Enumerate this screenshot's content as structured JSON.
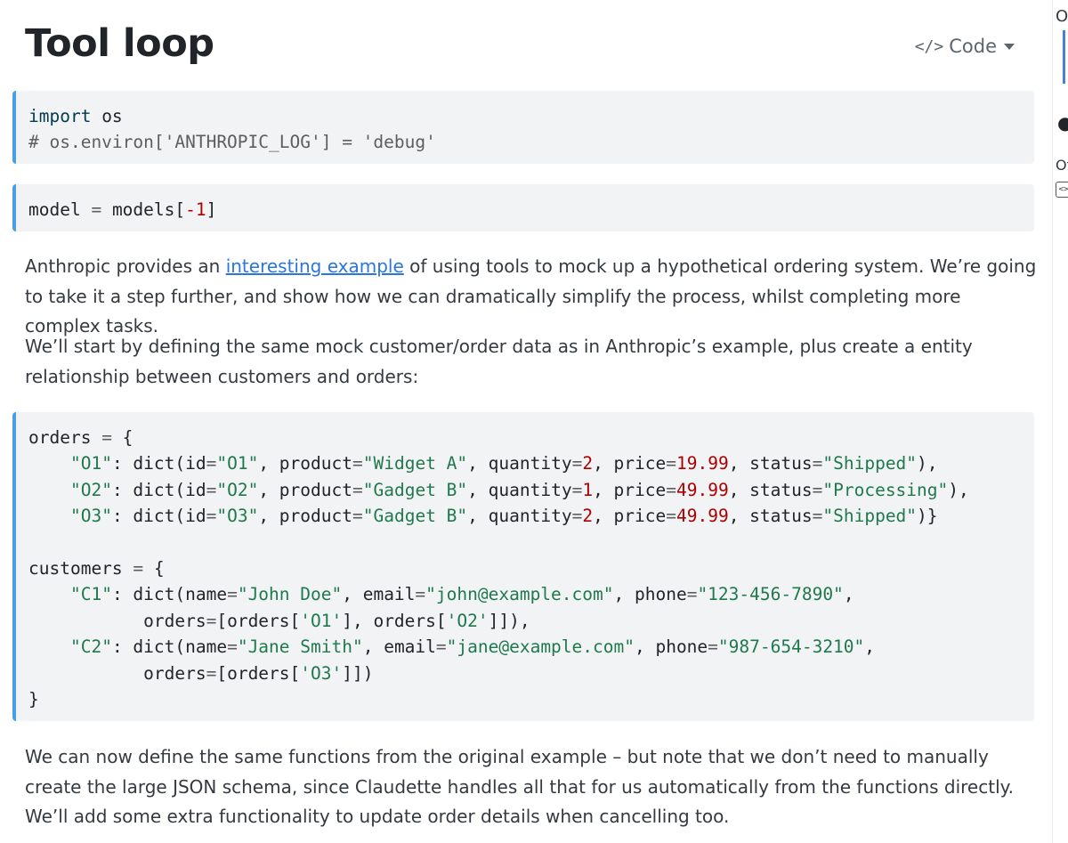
{
  "header": {
    "title": "Tool loop",
    "code_toggle_label": "Code"
  },
  "code_cells": [
    {
      "lines": [
        [
          {
            "t": "import",
            "c": "kw"
          },
          {
            "t": " os",
            "c": ""
          }
        ],
        [
          {
            "t": "# os.environ['ANTHROPIC_LOG'] = 'debug'",
            "c": "cm"
          }
        ]
      ]
    },
    {
      "lines": [
        [
          {
            "t": "model ",
            "c": ""
          },
          {
            "t": "=",
            "c": "op"
          },
          {
            "t": " models[",
            "c": ""
          },
          {
            "t": "-1",
            "c": "num"
          },
          {
            "t": "]",
            "c": ""
          }
        ]
      ]
    },
    {
      "lines": [
        [
          {
            "t": "orders ",
            "c": ""
          },
          {
            "t": "=",
            "c": "op"
          },
          {
            "t": " {",
            "c": ""
          }
        ],
        [
          {
            "t": "    ",
            "c": ""
          },
          {
            "t": "\"O1\"",
            "c": "str"
          },
          {
            "t": ": dict(",
            "c": ""
          },
          {
            "t": "id",
            "c": ""
          },
          {
            "t": "=",
            "c": "op"
          },
          {
            "t": "\"O1\"",
            "c": "str"
          },
          {
            "t": ", product",
            "c": ""
          },
          {
            "t": "=",
            "c": "op"
          },
          {
            "t": "\"Widget A\"",
            "c": "str"
          },
          {
            "t": ", quantity",
            "c": ""
          },
          {
            "t": "=",
            "c": "op"
          },
          {
            "t": "2",
            "c": "num"
          },
          {
            "t": ", price",
            "c": ""
          },
          {
            "t": "=",
            "c": "op"
          },
          {
            "t": "19.99",
            "c": "num"
          },
          {
            "t": ", status",
            "c": ""
          },
          {
            "t": "=",
            "c": "op"
          },
          {
            "t": "\"Shipped\"",
            "c": "str"
          },
          {
            "t": "),",
            "c": ""
          }
        ],
        [
          {
            "t": "    ",
            "c": ""
          },
          {
            "t": "\"O2\"",
            "c": "str"
          },
          {
            "t": ": dict(",
            "c": ""
          },
          {
            "t": "id",
            "c": ""
          },
          {
            "t": "=",
            "c": "op"
          },
          {
            "t": "\"O2\"",
            "c": "str"
          },
          {
            "t": ", product",
            "c": ""
          },
          {
            "t": "=",
            "c": "op"
          },
          {
            "t": "\"Gadget B\"",
            "c": "str"
          },
          {
            "t": ", quantity",
            "c": ""
          },
          {
            "t": "=",
            "c": "op"
          },
          {
            "t": "1",
            "c": "num"
          },
          {
            "t": ", price",
            "c": ""
          },
          {
            "t": "=",
            "c": "op"
          },
          {
            "t": "49.99",
            "c": "num"
          },
          {
            "t": ", status",
            "c": ""
          },
          {
            "t": "=",
            "c": "op"
          },
          {
            "t": "\"Processing\"",
            "c": "str"
          },
          {
            "t": "),",
            "c": ""
          }
        ],
        [
          {
            "t": "    ",
            "c": ""
          },
          {
            "t": "\"O3\"",
            "c": "str"
          },
          {
            "t": ": dict(",
            "c": ""
          },
          {
            "t": "id",
            "c": ""
          },
          {
            "t": "=",
            "c": "op"
          },
          {
            "t": "\"O3\"",
            "c": "str"
          },
          {
            "t": ", product",
            "c": ""
          },
          {
            "t": "=",
            "c": "op"
          },
          {
            "t": "\"Gadget B\"",
            "c": "str"
          },
          {
            "t": ", quantity",
            "c": ""
          },
          {
            "t": "=",
            "c": "op"
          },
          {
            "t": "2",
            "c": "num"
          },
          {
            "t": ", price",
            "c": ""
          },
          {
            "t": "=",
            "c": "op"
          },
          {
            "t": "49.99",
            "c": "num"
          },
          {
            "t": ", status",
            "c": ""
          },
          {
            "t": "=",
            "c": "op"
          },
          {
            "t": "\"Shipped\"",
            "c": "str"
          },
          {
            "t": ")}",
            "c": ""
          }
        ],
        [],
        [
          {
            "t": "customers ",
            "c": ""
          },
          {
            "t": "=",
            "c": "op"
          },
          {
            "t": " {",
            "c": ""
          }
        ],
        [
          {
            "t": "    ",
            "c": ""
          },
          {
            "t": "\"C1\"",
            "c": "str"
          },
          {
            "t": ": dict(name",
            "c": ""
          },
          {
            "t": "=",
            "c": "op"
          },
          {
            "t": "\"John Doe\"",
            "c": "str"
          },
          {
            "t": ", email",
            "c": ""
          },
          {
            "t": "=",
            "c": "op"
          },
          {
            "t": "\"john@example.com\"",
            "c": "str"
          },
          {
            "t": ", phone",
            "c": ""
          },
          {
            "t": "=",
            "c": "op"
          },
          {
            "t": "\"123-456-7890\"",
            "c": "str"
          },
          {
            "t": ",",
            "c": ""
          }
        ],
        [
          {
            "t": "           orders",
            "c": ""
          },
          {
            "t": "=",
            "c": "op"
          },
          {
            "t": "[orders[",
            "c": ""
          },
          {
            "t": "'O1'",
            "c": "str"
          },
          {
            "t": "], orders[",
            "c": ""
          },
          {
            "t": "'O2'",
            "c": "str"
          },
          {
            "t": "]]),",
            "c": ""
          }
        ],
        [
          {
            "t": "    ",
            "c": ""
          },
          {
            "t": "\"C2\"",
            "c": "str"
          },
          {
            "t": ": dict(name",
            "c": ""
          },
          {
            "t": "=",
            "c": "op"
          },
          {
            "t": "\"Jane Smith\"",
            "c": "str"
          },
          {
            "t": ", email",
            "c": ""
          },
          {
            "t": "=",
            "c": "op"
          },
          {
            "t": "\"jane@example.com\"",
            "c": "str"
          },
          {
            "t": ", phone",
            "c": ""
          },
          {
            "t": "=",
            "c": "op"
          },
          {
            "t": "\"987-654-3210\"",
            "c": "str"
          },
          {
            "t": ",",
            "c": ""
          }
        ],
        [
          {
            "t": "           orders",
            "c": ""
          },
          {
            "t": "=",
            "c": "op"
          },
          {
            "t": "[orders[",
            "c": ""
          },
          {
            "t": "'O3'",
            "c": "str"
          },
          {
            "t": "]])",
            "c": ""
          }
        ],
        [
          {
            "t": "}",
            "c": ""
          }
        ]
      ]
    }
  ],
  "paragraphs": {
    "p1": {
      "before": "Anthropic provides an ",
      "link": "interesting example",
      "after": " of using tools to mock up a hypothetical ordering system. We’re going to take it a step further, and show how we can dramatically simplify the process, whilst completing more complex tasks."
    },
    "p2": "We’ll start by defining the same mock customer/order data as in Anthropic’s example, plus create a entity relationship between customers and orders:",
    "p3": "We can now define the same functions from the original example – but note that we don’t need to manually create the large JSON schema, since Claudette handles all that for us automatically from the functions directly. We’ll add some extra functionality to update order details when cancelling too."
  },
  "right_sidebar": {
    "label_top": "O",
    "label_mid": "Ot",
    "code_icon_text": "<>"
  },
  "colors": {
    "accent": "#4a9fe0",
    "link": "#2a76dd",
    "string": "#20794d",
    "number": "#ad0000",
    "keyword": "#003b4f",
    "code_bg": "#f1f3f5"
  }
}
